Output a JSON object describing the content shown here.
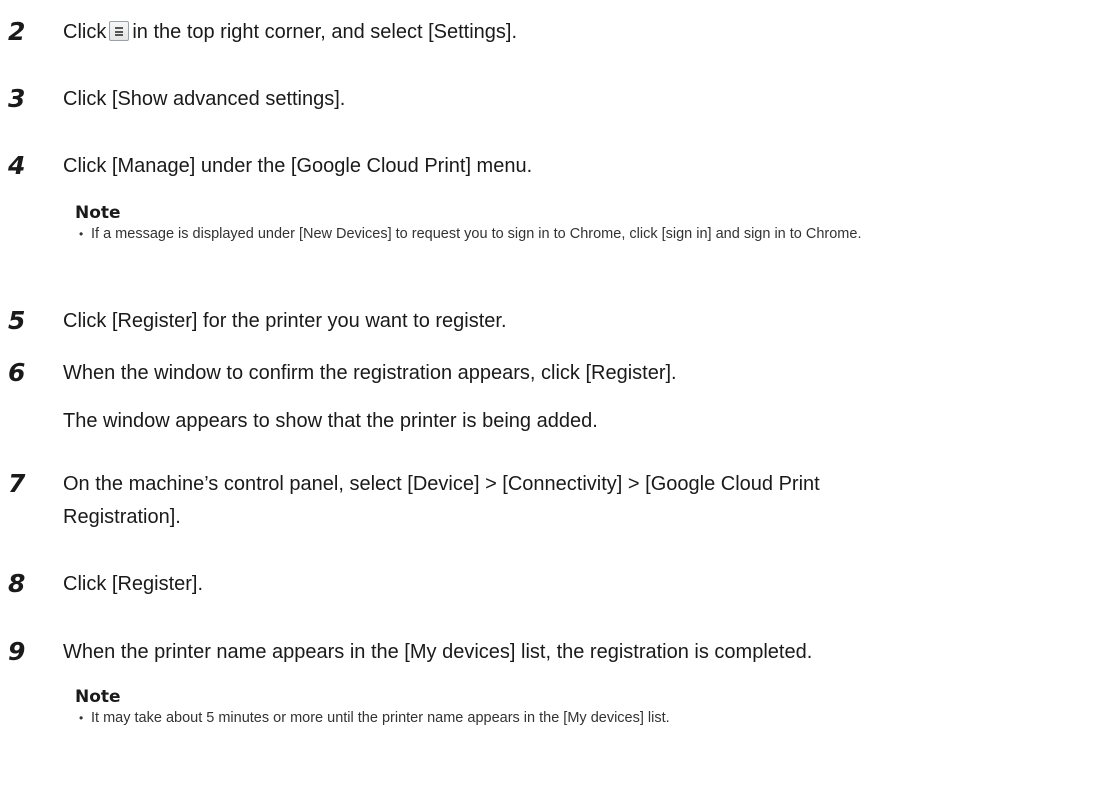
{
  "steps": [
    {
      "number": "2",
      "text_before_icon": "Click",
      "icon": "hamburger-menu-icon",
      "text_after_icon": "in the top right corner, and select [Settings]."
    },
    {
      "number": "3",
      "text": "Click [Show advanced settings]."
    },
    {
      "number": "4",
      "text": "Click [Manage] under the [Google Cloud Print] menu.",
      "note": {
        "title": "Note",
        "items": [
          "If a message is displayed under [New Devices] to request you to sign in to Chrome, click [sign in] and sign in to Chrome."
        ]
      }
    },
    {
      "number": "5",
      "text": "Click [Register] for the printer you want to register."
    },
    {
      "number": "6",
      "text": "When the window to confirm the registration appears, click [Register].",
      "subtext": "The window appears to show that the printer is being added."
    },
    {
      "number": "7",
      "text": "On the machine’s control panel, select [Device] > [Connectivity] > [Google Cloud Print Registration]."
    },
    {
      "number": "8",
      "text": "Click [Register]."
    },
    {
      "number": "9",
      "text": "When the printer name appears in the [My devices] list, the registration is completed.",
      "note": {
        "title": "Note",
        "items": [
          "It may take about 5 minutes or more until the printer name appears in the [My devices] list."
        ]
      }
    }
  ]
}
